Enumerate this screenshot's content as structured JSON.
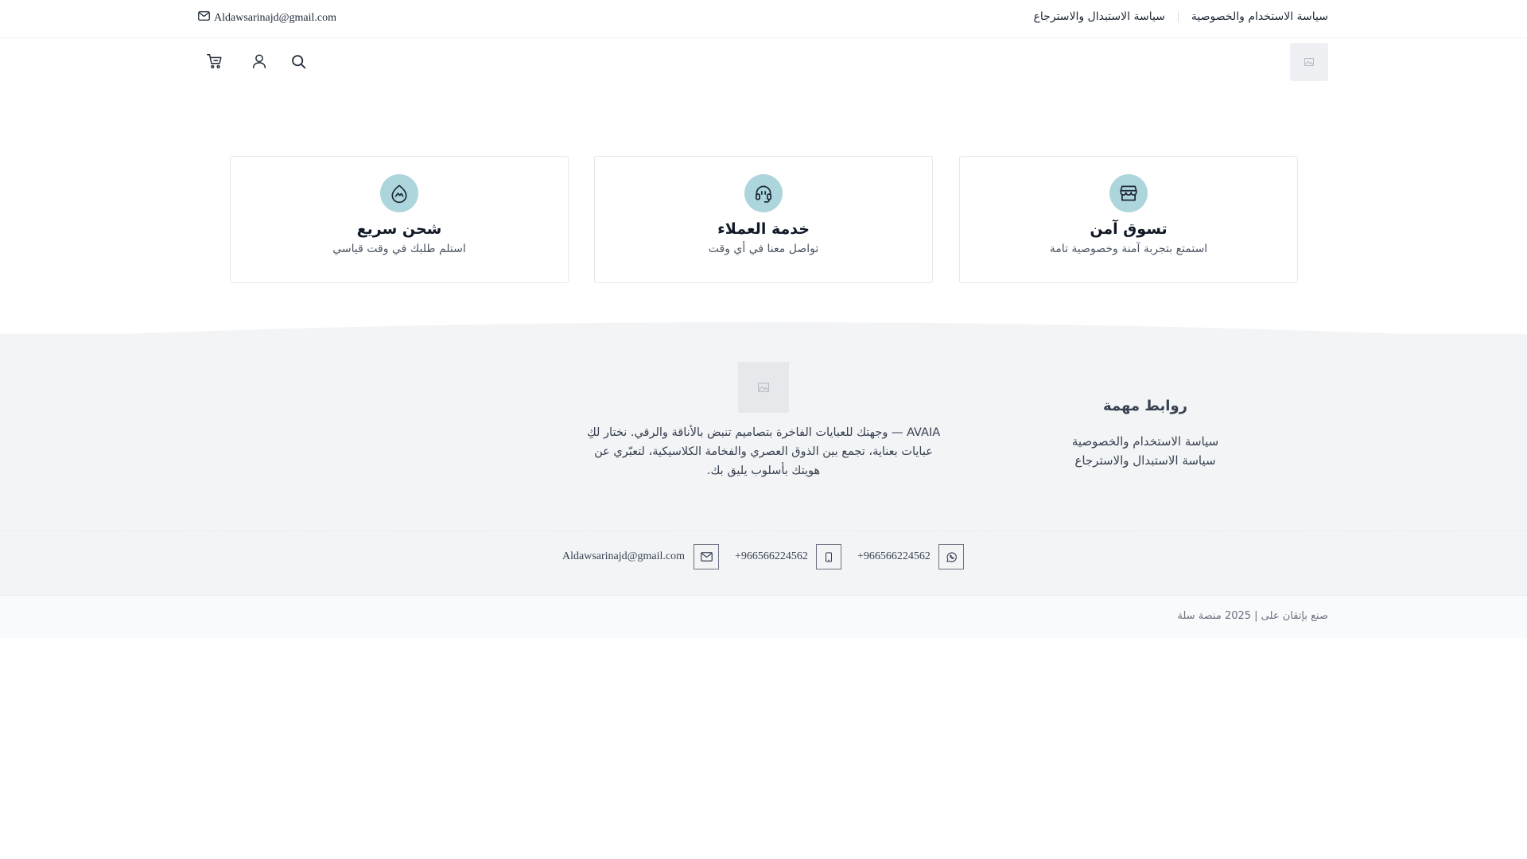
{
  "topbar": {
    "email": "Aldawsarinajd@gmail.com",
    "links": [
      "سياسة الاستخدام والخصوصية",
      "سياسة الاستبدال والاسترجاع"
    ]
  },
  "header": {
    "icons": [
      "cart-icon",
      "user-icon",
      "search-icon"
    ]
  },
  "features": [
    {
      "title": "تسوق آمن",
      "desc": "استمتع بتجربة آمنة وخصوصية تامة",
      "icon": "store-icon"
    },
    {
      "title": "خدمة العملاء",
      "desc": "تواصل معنا في أي وقت",
      "icon": "headset-icon"
    },
    {
      "title": "شحن سريع",
      "desc": "استلم طلبك في وقت قياسي",
      "icon": "fast-shipping-icon"
    }
  ],
  "footer": {
    "about_lines": [
      "AVAIA — وجهتك للعبايات الفاخرة بتصاميم تنبض بالأناقة والرقي. نختار لكِ",
      "عبايات بعناية، تجمع بين الذوق العصري والفخامة الكلاسيكية، لتعبّري عن",
      "هويتك بأسلوب يليق بك."
    ],
    "links_heading": "روابط مهمة",
    "links": [
      "سياسة الاستخدام والخصوصية",
      "سياسة الاستبدال والاسترجاع"
    ],
    "contacts": {
      "whatsapp": "+966566224562",
      "phone": "+966566224562",
      "email": "Aldawsarinajd@gmail.com"
    },
    "credit": "صنع بإتقان على | 2025 منصة سلة"
  },
  "colors": {
    "accent_circle": "#acd6dc",
    "footer_bg": "#f3f4f6"
  }
}
